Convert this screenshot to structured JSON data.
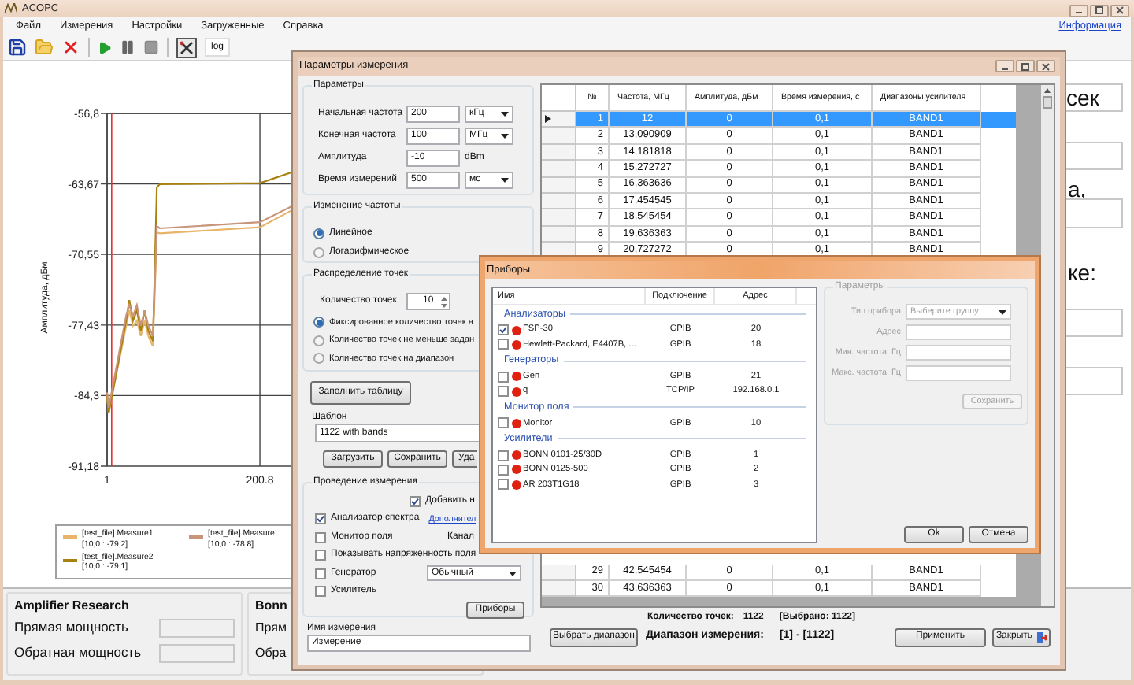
{
  "main_window": {
    "title": "ACOPC"
  },
  "menu": [
    "Файл",
    "Измерения",
    "Настройки",
    "Загруженные",
    "Справка"
  ],
  "info_link": "Информация",
  "toolbar": {
    "log_button": "log"
  },
  "chart": {
    "chart_data": {
      "type": "line",
      "ylabel": "Амплитуда, дБм",
      "x": [
        1,
        3,
        26,
        30,
        35,
        40,
        45,
        50,
        55,
        61,
        66,
        70,
        200.8,
        244
      ],
      "yticks": [
        {
          "value": -56.8,
          "label": "-56,8"
        },
        {
          "value": -63.67,
          "label": "-63,67"
        },
        {
          "value": -70.55,
          "label": "-70,55"
        },
        {
          "value": -77.43,
          "label": "-77,43"
        },
        {
          "value": -84.3,
          "label": "-84,3"
        },
        {
          "value": -91.18,
          "label": "-91,18"
        }
      ],
      "xticks": [
        1,
        200.8
      ],
      "xlim": [
        1,
        244
      ],
      "ylim": [
        -91.18,
        -56.8
      ],
      "grid": true,
      "ref_lines": [
        {
          "axis": "x",
          "value": 7,
          "color": "#e03030"
        }
      ],
      "series": [
        {
          "name": "[test_file].Measure1",
          "color": "#e8b468",
          "values": [
            -84.3,
            -86,
            -77.5,
            -76,
            -77.5,
            -77,
            -78.5,
            -77,
            -78.5,
            -79.5,
            -68.4,
            -68.5,
            -67.9,
            -66.2
          ]
        },
        {
          "name": "[test_file].Measure2",
          "color": "#a8820f",
          "values": [
            -84.3,
            -86,
            -77,
            -75,
            -77,
            -76,
            -78,
            -76,
            -78,
            -79,
            -64,
            -63.7,
            -63.6,
            -62.5
          ]
        },
        {
          "name": "[test_file].Measure",
          "color": "#c9957a",
          "values": [
            -84,
            -85.5,
            -76.5,
            -75.5,
            -76.5,
            -75.5,
            -77.5,
            -76,
            -77.5,
            -78.5,
            -67.8,
            -68,
            -67.4,
            -65.8
          ]
        }
      ]
    },
    "legend": [
      {
        "reading": "[10,0 : -79,2]"
      },
      {
        "reading": "[10,0 : -79,1]"
      },
      {
        "reading": "[10,0 : -78,8]"
      }
    ]
  },
  "right_fragments": [
    "сек",
    "а,",
    "ке:"
  ],
  "amplifier_panels": [
    {
      "title": "Amplifier Research",
      "rows": [
        "Прямая мощность",
        "Обратная мощность"
      ]
    },
    {
      "title": "Bonn",
      "rows": [
        "Прям",
        "Обра"
      ]
    }
  ],
  "params_dialog": {
    "title": "Параметры измерения",
    "parameters": {
      "title": "Параметры",
      "rows": [
        {
          "label": "Начальная частота",
          "value": "200",
          "unit": "кГц",
          "kind": "dropdown"
        },
        {
          "label": "Конечная частота",
          "value": "100",
          "unit": "МГц",
          "kind": "dropdown"
        },
        {
          "label": "Амплитуда",
          "value": "-10",
          "unit": "dBm",
          "kind": "text"
        },
        {
          "label": "Время измерений",
          "value": "500",
          "unit": "мс",
          "kind": "dropdown"
        }
      ]
    },
    "frequency_change": {
      "title": "Изменение частоты",
      "options": [
        {
          "label": "Линейное",
          "selected": true
        },
        {
          "label": "Логарифмическое",
          "selected": false
        }
      ]
    },
    "points": {
      "title": "Распределение точек",
      "count_label": "Количество точек",
      "count": "10",
      "options": [
        {
          "label": "Фиксированное количество точек н",
          "selected": true
        },
        {
          "label": "Количество точек не меньше задан",
          "selected": false
        },
        {
          "label": "Количество точек на диапазон",
          "selected": false
        }
      ]
    },
    "fill_button": "Заполнить таблицу",
    "template": {
      "title": "Шаблон",
      "value": "1122 with bands",
      "buttons": [
        "Загрузить",
        "Сохранить",
        "Уда"
      ]
    },
    "measurement": {
      "title": "Проведение измерения",
      "add": {
        "label": "Добавить н",
        "checked": true
      },
      "items": [
        {
          "label": "Анализатор спектра",
          "checked": true,
          "extra": {
            "kind": "link",
            "text": "Дополнител"
          }
        },
        {
          "label": "Монитор поля",
          "checked": false,
          "extra": {
            "kind": "label",
            "text": "Канал"
          }
        },
        {
          "label": "Показывать напряженность поля",
          "checked": false
        },
        {
          "label": "Генератор",
          "checked": false,
          "extra": {
            "kind": "dropdown",
            "text": "Обычный"
          }
        },
        {
          "label": "Усилитель",
          "checked": false
        }
      ],
      "devices_button": "Приборы"
    },
    "name": {
      "label": "Имя измерения",
      "value": "Измерение"
    },
    "table": {
      "columns": [
        "№",
        "Частота, МГц",
        "Амплитуда, дБм",
        "Время измерения, с",
        "Диапазоны усилителя"
      ],
      "rows": [
        {
          "cells": [
            "1",
            "12",
            "0",
            "0,1",
            "BAND1"
          ],
          "selected": true
        },
        {
          "cells": [
            "2",
            "13,090909",
            "0",
            "0,1",
            "BAND1"
          ],
          "selected": false
        },
        {
          "cells": [
            "3",
            "14,181818",
            "0",
            "0,1",
            "BAND1"
          ],
          "selected": false
        },
        {
          "cells": [
            "4",
            "15,272727",
            "0",
            "0,1",
            "BAND1"
          ],
          "selected": false
        },
        {
          "cells": [
            "5",
            "16,363636",
            "0",
            "0,1",
            "BAND1"
          ],
          "selected": false
        },
        {
          "cells": [
            "6",
            "17,454545",
            "0",
            "0,1",
            "BAND1"
          ],
          "selected": false
        },
        {
          "cells": [
            "7",
            "18,545454",
            "0",
            "0,1",
            "BAND1"
          ],
          "selected": false
        },
        {
          "cells": [
            "8",
            "19,636363",
            "0",
            "0,1",
            "BAND1"
          ],
          "selected": false
        },
        {
          "cells": [
            "9",
            "20,727272",
            "0",
            "0,1",
            "BAND1"
          ],
          "selected": false
        }
      ],
      "rows_after": [
        {
          "cells": [
            "29",
            "42,545454",
            "0",
            "0,1",
            "BAND1"
          ],
          "selected": false
        },
        {
          "cells": [
            "30",
            "43,636363",
            "0",
            "0,1",
            "BAND1"
          ],
          "selected": false
        }
      ]
    },
    "summary": {
      "points_label": "Количество точек:",
      "points_value": "1122",
      "selected_label": "[Выбрано: 1122]",
      "range_button": "Выбрать диапазон",
      "range_label": "Диапазон измерения:",
      "range_value": "[1] - [1122]",
      "apply_button": "Применить",
      "close_button": "Закрыть"
    }
  },
  "devices_dialog": {
    "title": "Приборы",
    "columns": [
      "Имя",
      "Подключение",
      "Адрес"
    ],
    "groups": [
      {
        "name": "Анализаторы",
        "devices": [
          {
            "name": "FSP-30",
            "connection": "GPIB",
            "address": "20",
            "checked": true,
            "color": "#e02010"
          },
          {
            "name": "Hewlett-Packard, E4407B, ...",
            "connection": "GPIB",
            "address": "18",
            "checked": false,
            "color": "#e02010"
          }
        ]
      },
      {
        "name": "Генераторы",
        "devices": [
          {
            "name": "Gen",
            "connection": "GPIB",
            "address": "21",
            "checked": false,
            "color": "#e02010"
          },
          {
            "name": "q",
            "connection": "TCP/IP",
            "address": "192.168.0.1",
            "checked": false,
            "color": "#e02010"
          }
        ]
      },
      {
        "name": "Монитор поля",
        "devices": [
          {
            "name": "Monitor",
            "connection": "GPIB",
            "address": "10",
            "checked": false,
            "color": "#e02010"
          }
        ]
      },
      {
        "name": "Усилители",
        "devices": [
          {
            "name": "BONN 0101-25/30D",
            "connection": "GPIB",
            "address": "1",
            "checked": false,
            "color": "#e02010"
          },
          {
            "name": "BONN 0125-500",
            "connection": "GPIB",
            "address": "2",
            "checked": false,
            "color": "#e02010"
          },
          {
            "name": "AR 203T1G18",
            "connection": "GPIB",
            "address": "3",
            "checked": false,
            "color": "#e02010"
          }
        ]
      }
    ],
    "parameters": {
      "title": "Параметры",
      "disabled": true,
      "fields": [
        {
          "label": "Тип прибора",
          "value": "Выберите группу",
          "kind": "dropdown"
        },
        {
          "label": "Адрес",
          "kind": "text"
        },
        {
          "label": "Мин. частота, Гц",
          "kind": "text"
        },
        {
          "label": "Макс. частота, Гц",
          "kind": "text"
        }
      ],
      "save_button": "Сохранить"
    },
    "buttons": [
      "Ok",
      "Отмена"
    ]
  }
}
